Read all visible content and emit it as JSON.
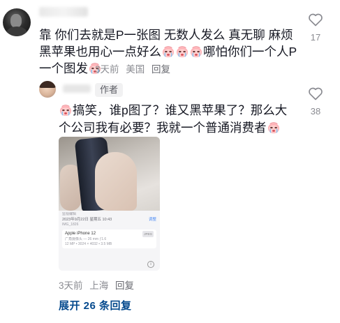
{
  "comment": {
    "text": "靠 你们去就是P一张图 无数人发么 真无聊 麻烦黑苹果也用心一点好么",
    "text_tail": "哪怕你们一个人P一个图发",
    "time": "3天前",
    "location": "美国",
    "reply_label": "回复",
    "like_count": "17"
  },
  "reply": {
    "author_badge": "作者",
    "text_start": "搞笑，谁p图了？谁又黑苹果了？那么大个公司我有必要？我就一个普通消费者",
    "time": "3天前",
    "location": "上海",
    "reply_label": "回复",
    "like_count": "38",
    "image": {
      "screenshot_title": "监视编辑",
      "datetime": "2023年9月22日 星期五 10:43",
      "filename": "IMG_1826",
      "edit_label": "调整",
      "device": "Apple iPhone 12",
      "device_tag": "JPEG",
      "lens": "广角摄像头 — 26 mm ƒ1.6",
      "specs": "12 MP • 3024 × 4032 • 3.5 MB",
      "info_icon": "i"
    }
  },
  "expand_replies": "展开 26 条回复",
  "colors": {
    "text": "#161823",
    "meta": "#8a8b91",
    "link": "#04498d",
    "badge_bg": "#f1f1f2"
  },
  "icons": [
    "heart-outline-icon",
    "crying-face-emoji"
  ]
}
